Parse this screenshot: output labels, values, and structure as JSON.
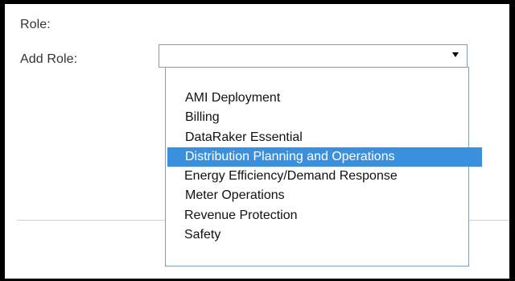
{
  "form": {
    "role_label": "Role:",
    "add_role_label": "Add Role:",
    "add_role_value": ""
  },
  "dropdown": {
    "options": [
      "AMI Deployment",
      "Billing",
      "DataRaker Essential",
      "Distribution Planning and Operations",
      "Energy Efficiency/Demand Response",
      "Meter Operations",
      "Revenue Protection",
      "Safety"
    ],
    "highlighted": "Distribution Planning and Operations"
  },
  "colors": {
    "highlight": "#3b90de",
    "border": "#7f9db9"
  }
}
